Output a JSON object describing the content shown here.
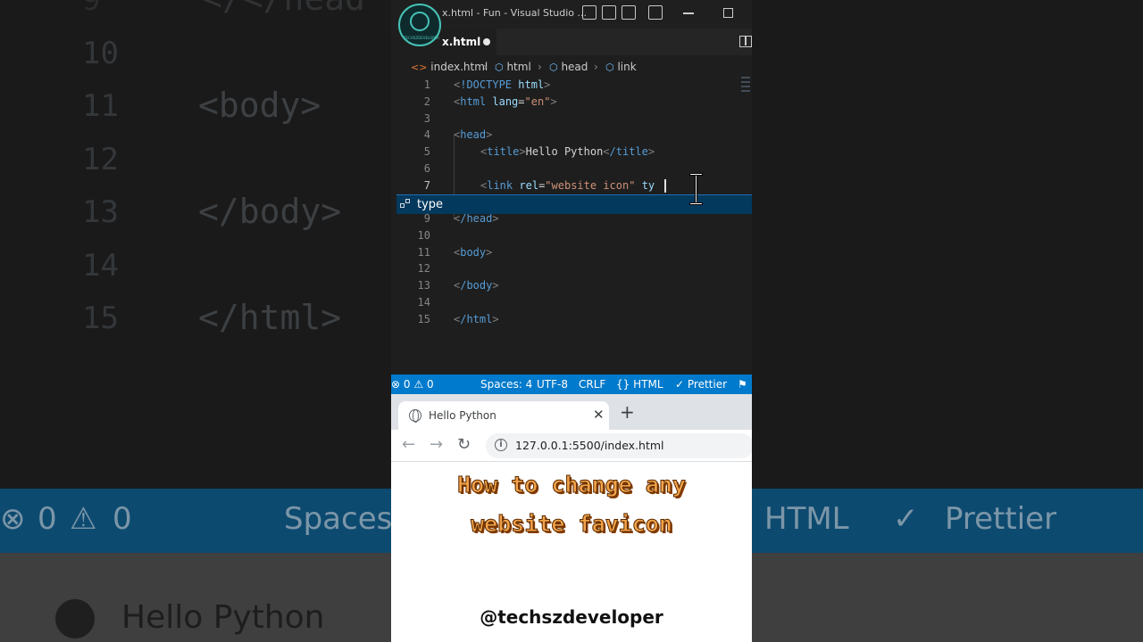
{
  "background": {
    "line_numbers": [
      "10",
      "11",
      "12",
      "13",
      "14",
      "15"
    ],
    "code_lines": [
      "</head",
      "<body>",
      "</body>",
      "</html>"
    ],
    "status_items": [
      "0",
      "0",
      "Spaces:",
      "HTML",
      "Prettier"
    ],
    "tab_title": "Hello Python"
  },
  "window": {
    "title": "x.html - Fun - Visual Studio ...",
    "logo_text": "TECHSZDEVELOPER"
  },
  "tab": {
    "label": "x.html"
  },
  "breadcrumb": {
    "file": "index.html",
    "items": [
      "html",
      "head",
      "link"
    ]
  },
  "editor": {
    "line_numbers": [
      "1",
      "2",
      "3",
      "4",
      "5",
      "6",
      "7",
      "9",
      "10",
      "11",
      "12",
      "13",
      "14",
      "15"
    ],
    "suggestion": "type",
    "lines": {
      "l1_tag": "!DOCTYPE",
      "l1_attr": "html",
      "l2_tag": "html",
      "l2_attr": "lang",
      "l2_val": "\"en\"",
      "l4_tag": "head",
      "l5_tag": "title",
      "l5_text": "Hello Python",
      "l5_close": "/title",
      "l7_tag": "link",
      "l7_attr": "rel",
      "l7_val": "\"website icon\"",
      "l7_typed": "ty",
      "l9_tag": "/head",
      "l11_tag": "body",
      "l13_tag": "/body",
      "l15_tag": "/html"
    }
  },
  "statusbar": {
    "errors": "0",
    "warnings": "0",
    "spaces": "Spaces: 4",
    "encoding": "UTF-8",
    "eol": "CRLF",
    "language": "HTML",
    "formatter": "Prettier"
  },
  "browser": {
    "tab_title": "Hello Python",
    "url": "127.0.0.1:5500/index.html"
  },
  "overlay": {
    "headline_1": "How to change any",
    "headline_2": "website favicon",
    "handle": "@techszdeveloper"
  },
  "colors": {
    "vscode_status": "#007acc",
    "tag": "#569cd6",
    "attribute": "#9cdcfe",
    "string": "#ce9178",
    "headline": "#f2a34a"
  }
}
